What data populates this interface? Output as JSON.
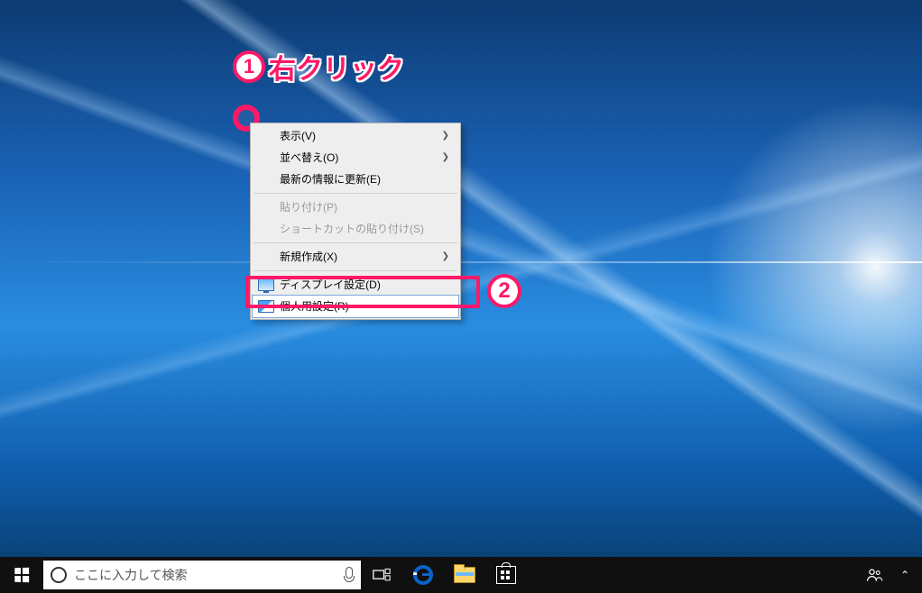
{
  "annotations": {
    "step1_number": "1",
    "step1_label": "右クリック",
    "step2_number": "2"
  },
  "context_menu": {
    "view": {
      "label": "表示(V)",
      "has_submenu": true
    },
    "sort": {
      "label": "並べ替え(O)",
      "has_submenu": true
    },
    "refresh": {
      "label": "最新の情報に更新(E)"
    },
    "paste": {
      "label": "貼り付け(P)",
      "disabled": true
    },
    "paste_short": {
      "label": "ショートカットの貼り付け(S)",
      "disabled": true
    },
    "new": {
      "label": "新規作成(X)",
      "has_submenu": true
    },
    "display": {
      "label": "ディスプレイ設定(D)"
    },
    "personalize": {
      "label": "個人用設定(R)",
      "highlighted": true
    }
  },
  "taskbar": {
    "search_placeholder": "ここに入力して検索"
  }
}
